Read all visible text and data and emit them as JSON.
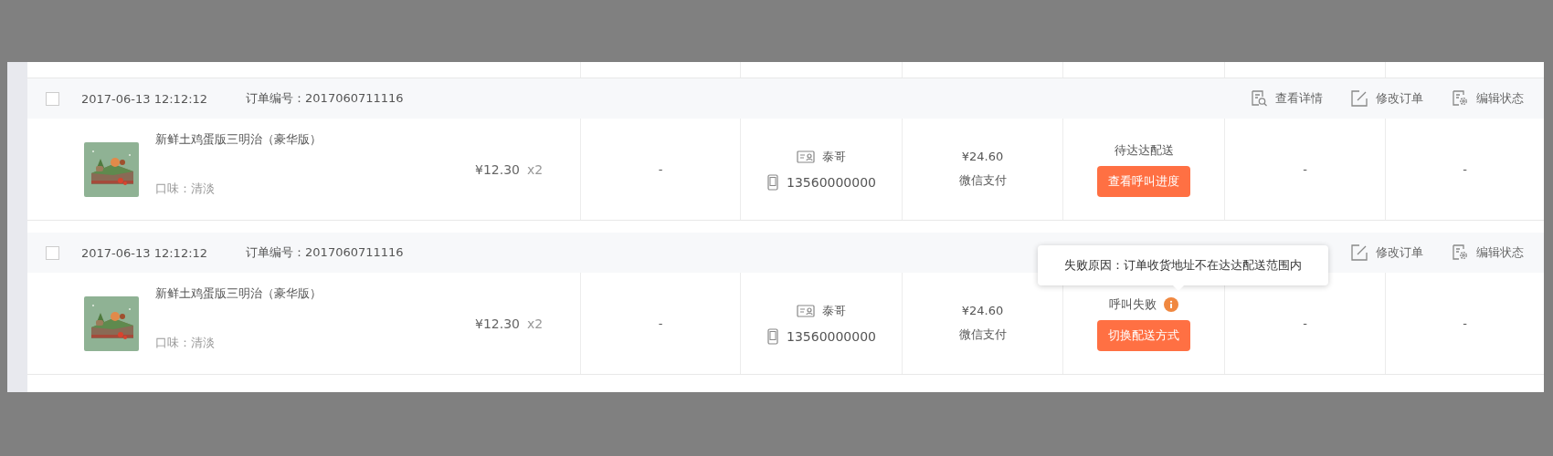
{
  "orders": [
    {
      "checked": false,
      "date": "2017-06-13 12:12:12",
      "order_no": "订单编号：2017060711116",
      "actions": [
        {
          "kind": "detail",
          "label": "查看详情"
        },
        {
          "kind": "edit",
          "label": "修改订单"
        },
        {
          "kind": "status",
          "label": "编辑状态"
        }
      ],
      "product": {
        "kind": "picture",
        "name": "新鲜土鸡蛋版三明治（豪华版）",
        "flavor": "口味：清淡",
        "price": "¥12.30",
        "qty": "x2"
      },
      "column_2": "-",
      "contact": {
        "name": "泰哥",
        "phone": "13560000000"
      },
      "total": "¥24.60",
      "payment": "微信支付",
      "status": {
        "text": "待达达配送",
        "failed": false,
        "button": "查看呼叫进度"
      },
      "column_6": "-",
      "column_7": "-"
    },
    {
      "checked": false,
      "date": "2017-06-13 12:12:12",
      "order_no": "订单编号：2017060711116",
      "actions": [
        {
          "kind": "edit",
          "label": "修改订单"
        },
        {
          "kind": "status",
          "label": "编辑状态"
        }
      ],
      "product": {
        "kind": "picture",
        "name": "新鲜土鸡蛋版三明治（豪华版）",
        "flavor": "口味：清淡",
        "price": "¥12.30",
        "qty": "x2"
      },
      "column_2": "-",
      "contact": {
        "name": "泰哥",
        "phone": "13560000000"
      },
      "total": "¥24.60",
      "payment": "微信支付",
      "status": {
        "text": "呼叫失败",
        "failed": true,
        "tooltip": "失败原因：订单收货地址不在达达配送范围内",
        "button": "切换配送方式"
      },
      "column_6": "-",
      "column_7": "-"
    }
  ]
}
